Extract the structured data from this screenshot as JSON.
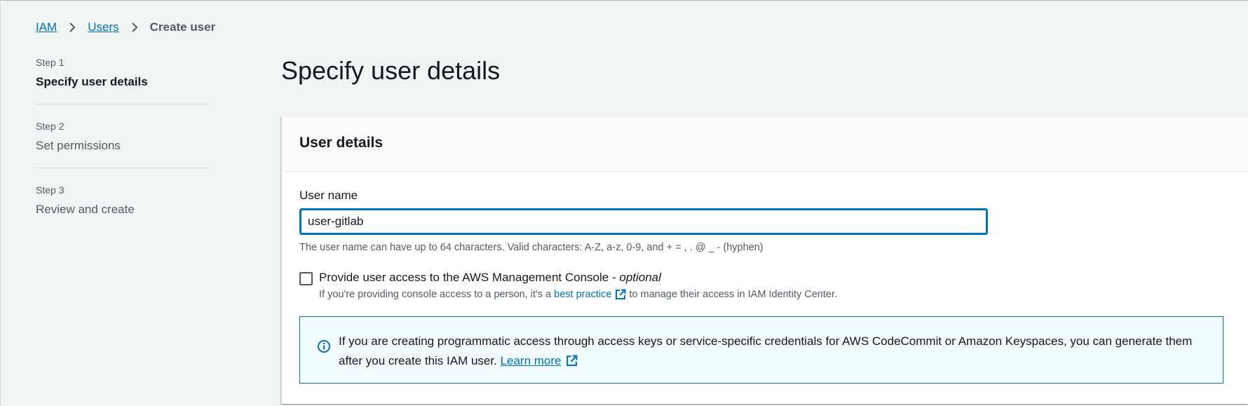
{
  "breadcrumb": {
    "items": [
      "IAM",
      "Users"
    ],
    "current": "Create user"
  },
  "steps": [
    {
      "number": "Step 1",
      "title": "Specify user details",
      "active": true
    },
    {
      "number": "Step 2",
      "title": "Set permissions",
      "active": false
    },
    {
      "number": "Step 3",
      "title": "Review and create",
      "active": false
    }
  ],
  "page": {
    "title": "Specify user details"
  },
  "user_details": {
    "heading": "User details",
    "username_label": "User name",
    "username_value": "user-gitlab",
    "username_hint": "The user name can have up to 64 characters. Valid characters: A-Z, a-z, 0-9, and + = , . @ _ - (hyphen)",
    "console_access": {
      "label": "Provide user access to the AWS Management Console - ",
      "optional": "optional",
      "checked": false,
      "desc_before": "If you're providing console access to a person, it's a",
      "desc_link": "best practice",
      "desc_after": "to manage their access in IAM Identity Center."
    },
    "info_alert": {
      "text": "If you are creating programmatic access through access keys or service-specific credentials for AWS CodeCommit or Amazon Keyspaces, you can generate them after you create this IAM user.",
      "link": "Learn more"
    }
  },
  "colors": {
    "link": "#0073bb",
    "background": "#f2f3f3",
    "alert_background": "#f1faff"
  },
  "icons": {
    "breadcrumb_separator": "chevron-right-icon",
    "external_link": "external-link-icon",
    "info": "info-icon"
  }
}
